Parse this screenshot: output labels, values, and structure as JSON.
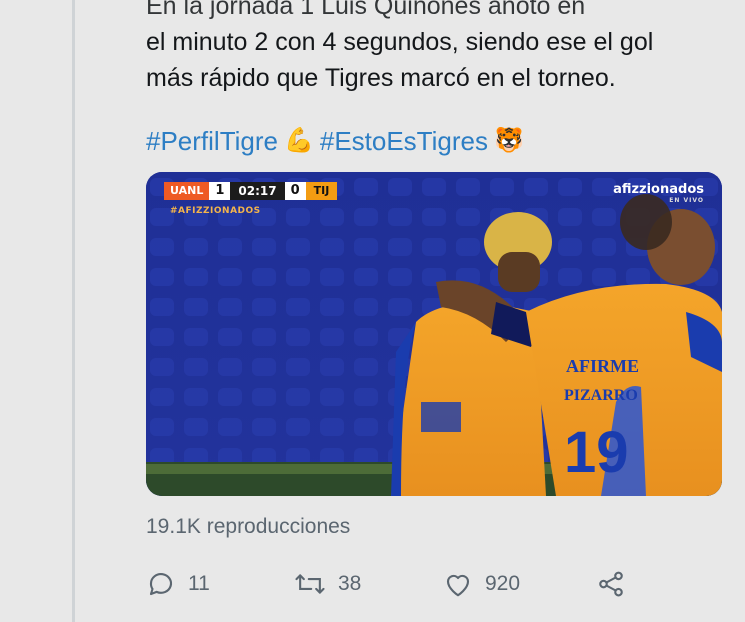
{
  "tweet": {
    "text_lines": [
      "En la jornada 1 Luis Quiñones anotó en",
      "el minuto 2 con 4 segundos, siendo ese el gol",
      "más rápido que Tigres marcó en el torneo."
    ],
    "hashtags": [
      "#PerfilTigre",
      "#EstoEsTigres"
    ],
    "emojis": {
      "flexed_arm": "💪",
      "tiger": "🐯"
    }
  },
  "video": {
    "scorebug": {
      "home_team": "UANL",
      "home_score": "1",
      "clock": "02:17",
      "away_score": "0",
      "away_team": "TIJ"
    },
    "overlay_hashtag": "#AFIZZIONADOS",
    "brand": "afizzionados",
    "brand_sub": "EN VIVO",
    "jersey_texts": [
      "AFIRME",
      "PIZARRO",
      "19"
    ]
  },
  "stats": {
    "views": "19.1K reproducciones"
  },
  "actions": {
    "reply_count": "11",
    "retweet_count": "38",
    "like_count": "920"
  },
  "colors": {
    "hashtag": "#2d7ec4",
    "muted_text": "#5b6670",
    "background": "#e8e8e8"
  }
}
